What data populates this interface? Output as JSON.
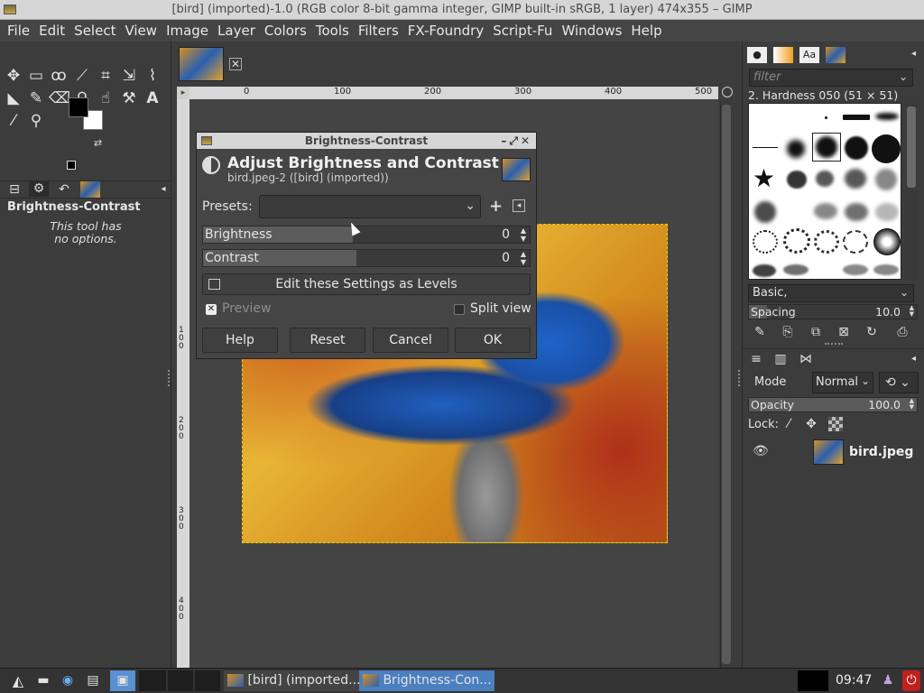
{
  "window": {
    "title": "[bird] (imported)-1.0 (RGB color 8-bit gamma integer, GIMP built-in sRGB, 1 layer) 474x355 – GIMP"
  },
  "menubar": [
    "File",
    "Edit",
    "Select",
    "View",
    "Image",
    "Layer",
    "Colors",
    "Tools",
    "Filters",
    "FX-Foundry",
    "Script-Fu",
    "Windows",
    "Help"
  ],
  "toolbox": {
    "tools_row1": [
      "move-tool-icon",
      "rect-select-icon",
      "free-select-icon",
      "fuzzy-select-icon",
      "crop-icon",
      "transform-icon",
      "warp-icon"
    ],
    "tools_row2": [
      "bucket-fill-icon",
      "paintbrush-icon",
      "eraser-icon",
      "clone-icon",
      "smudge-icon",
      "dodge-icon",
      "text-icon"
    ],
    "tools_row3": [
      "color-picker-icon",
      "zoom-icon"
    ],
    "options_title": "Brightness-Contrast",
    "options_text_1": "This tool has",
    "options_text_2": "no options."
  },
  "rulers": {
    "top": [
      "0",
      "100",
      "200",
      "300",
      "400",
      "500"
    ],
    "left": [
      "1 0 0",
      "2 0 0",
      "3 0 0",
      "4 0 0"
    ]
  },
  "dialog": {
    "title": "Brightness-Contrast",
    "heading": "Adjust Brightness and Contrast",
    "subtitle": "bird.jpeg-2 ([bird] (imported))",
    "presets_label": "Presets:",
    "presets_value": "",
    "brightness_label": "Brightness",
    "brightness_value": "0",
    "contrast_label": "Contrast",
    "contrast_value": "0",
    "levels_button": "Edit these Settings as Levels",
    "preview_label": "Preview",
    "preview_checked": true,
    "split_view_label": "Split view",
    "split_view_checked": false,
    "buttons": {
      "help": "Help",
      "reset": "Reset",
      "cancel": "Cancel",
      "ok": "OK"
    }
  },
  "brushes": {
    "filter_placeholder": "filter",
    "selected_name": "2. Hardness 050 (51 × 51)",
    "set": "Basic,",
    "spacing_label": "Spacing",
    "spacing_value": "10.0"
  },
  "layers": {
    "mode_label": "Mode",
    "mode_value": "Normal",
    "opacity_label": "Opacity",
    "opacity_value": "100.0",
    "lock_label": "Lock:",
    "items": [
      {
        "name": "bird.jpeg",
        "visible": true
      }
    ]
  },
  "taskbar": {
    "items": [
      "[bird] (imported...",
      "Brightness-Con..."
    ],
    "clock": "09:47"
  }
}
